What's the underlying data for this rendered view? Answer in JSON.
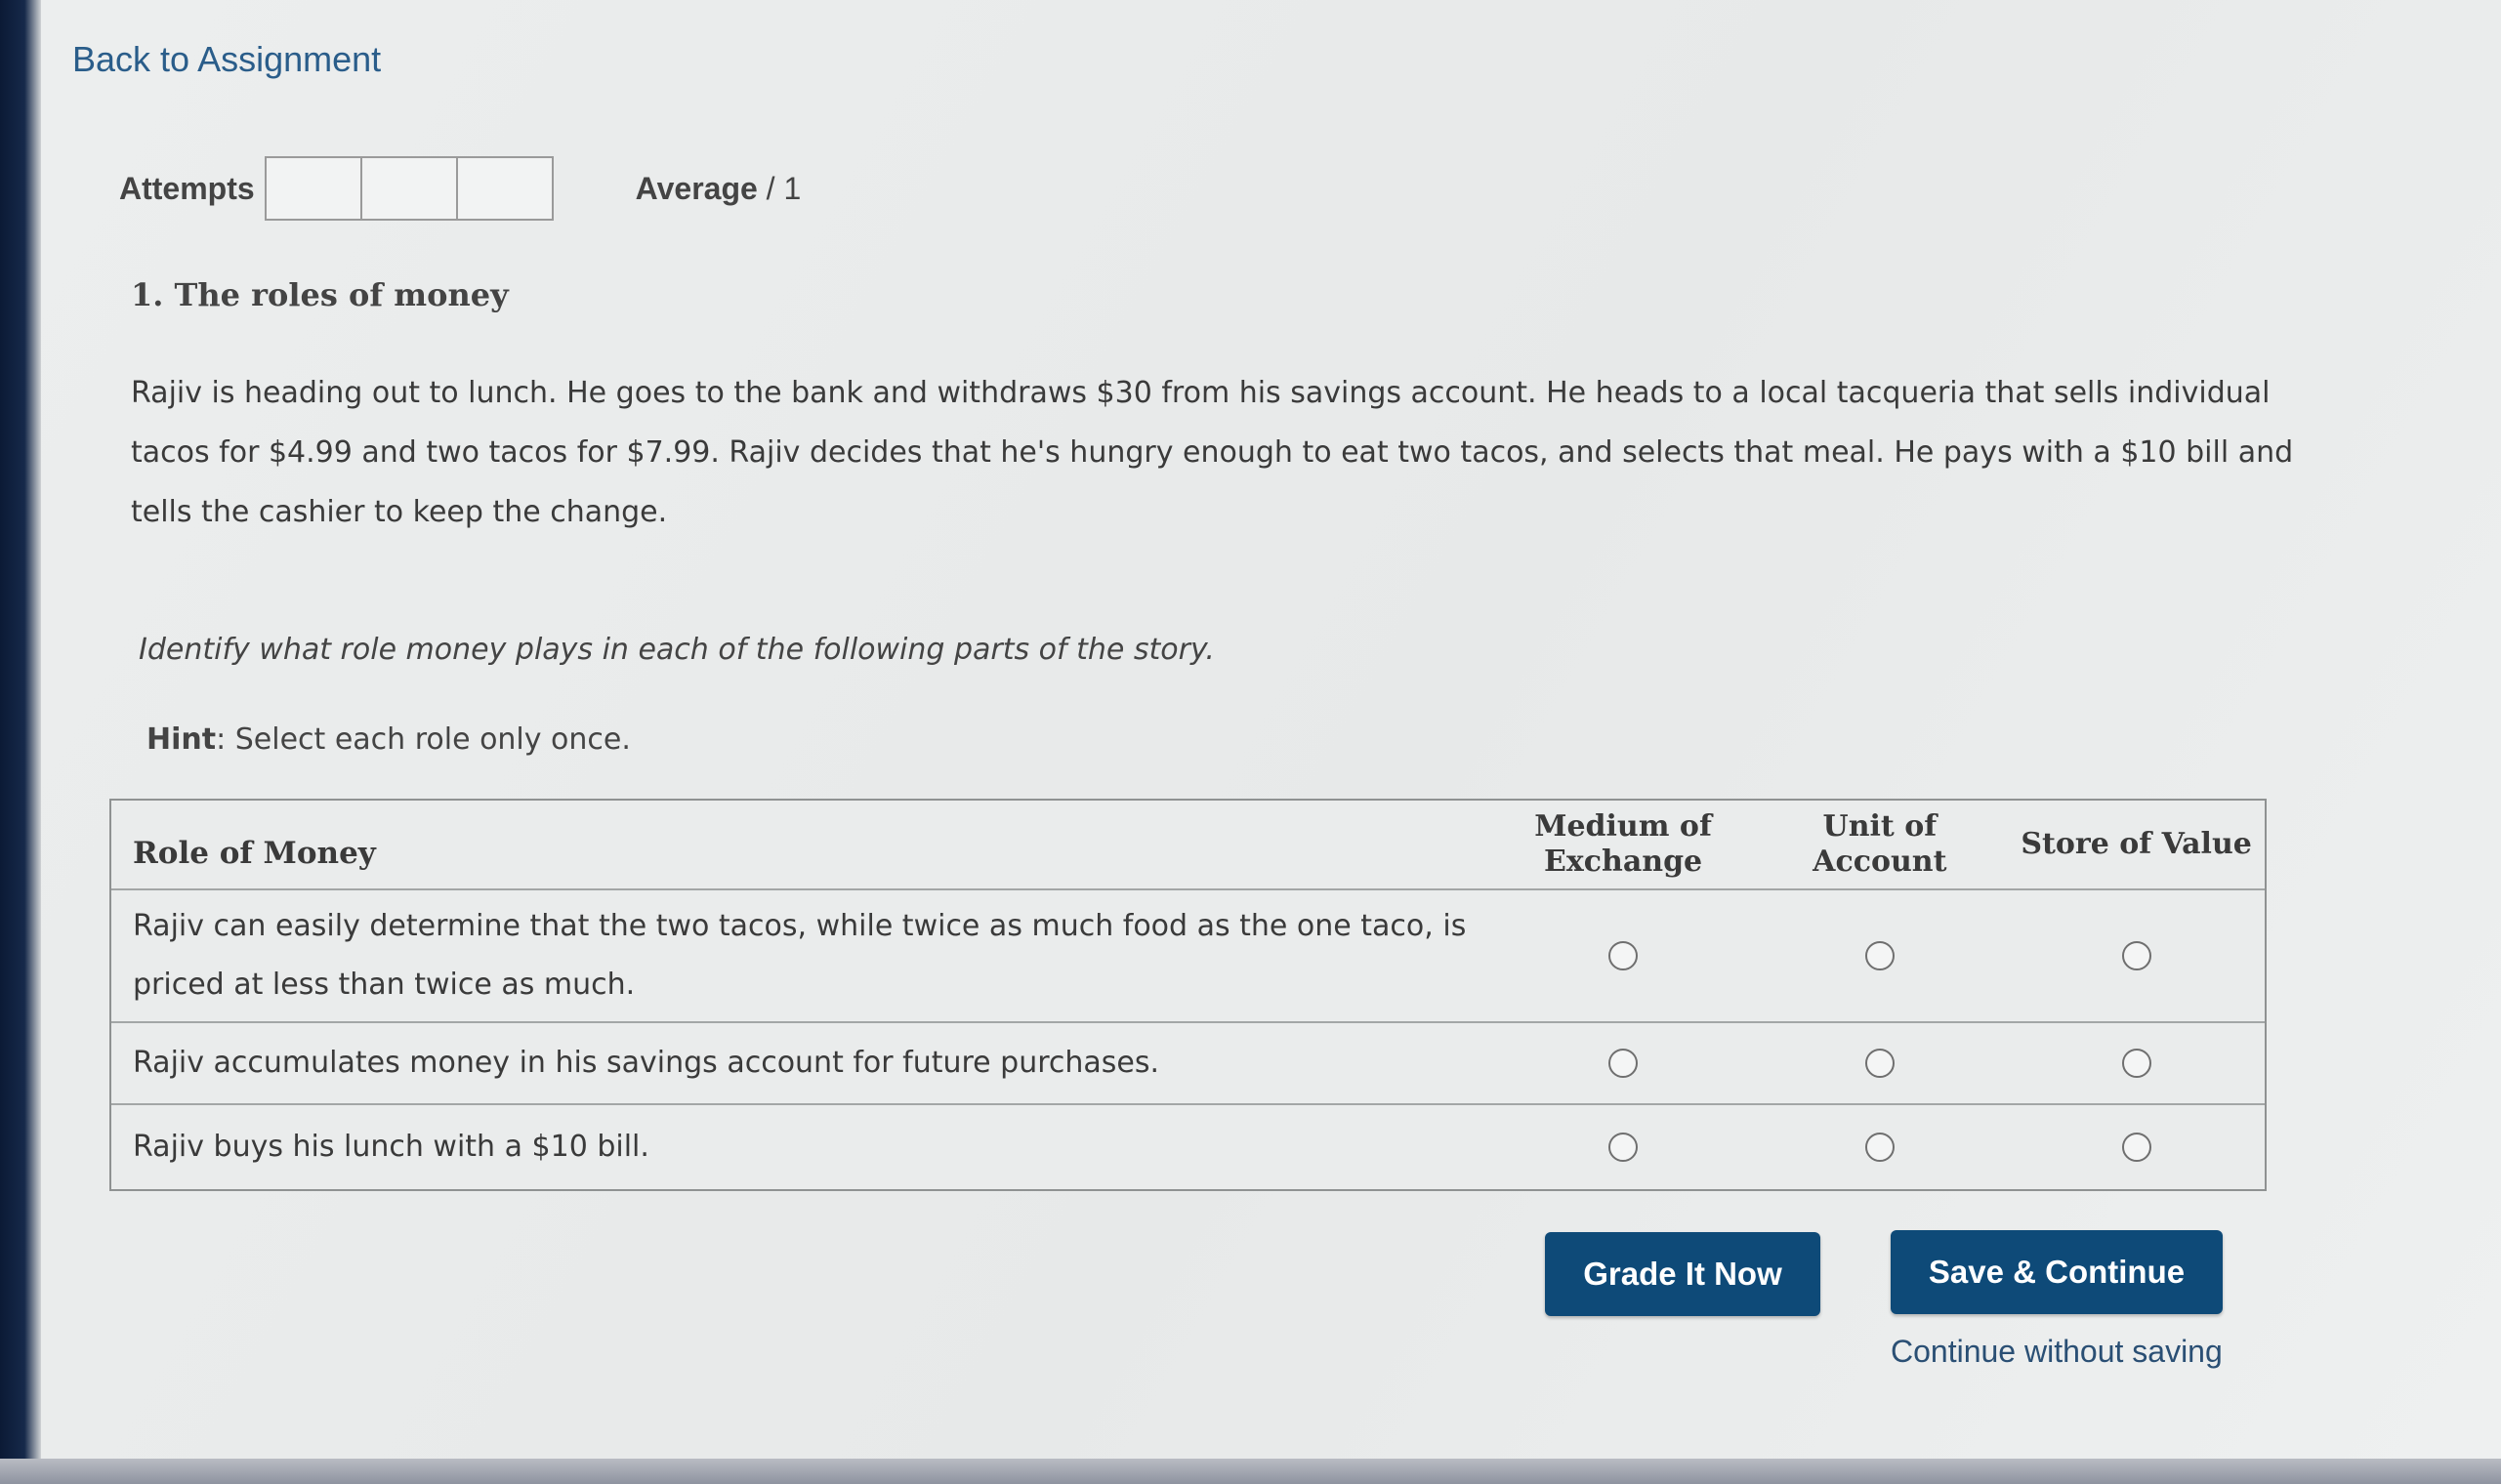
{
  "nav": {
    "back_label": "Back to Assignment"
  },
  "attempts": {
    "label": "Attempts",
    "average_label": "Average",
    "average_value": "/ 1"
  },
  "question": {
    "title": "1. The roles of money",
    "body": "Rajiv is heading out to lunch. He goes to the bank and withdraws $30 from his savings account. He heads to a local tacqueria that sells individual tacos for $4.99 and two tacos for $7.99. Rajiv decides that he's hungry enough to eat two tacos, and selects that meal. He pays with a $10 bill and tells the cashier to keep the change.",
    "instruction": "Identify what role money plays in each of the following parts of the story.",
    "hint_label": "Hint",
    "hint_text": ": Select each role only once."
  },
  "grid": {
    "header": "Role of Money",
    "columns": [
      "Medium of Exchange",
      "Unit of Account",
      "Store of Value"
    ],
    "rows": [
      "Rajiv can easily determine that the two tacos, while twice as much food as the one taco, is priced at less than twice as much.",
      "Rajiv accumulates money in his savings account for future purchases.",
      "Rajiv buys his lunch with a $10 bill."
    ]
  },
  "actions": {
    "grade_label": "Grade It Now",
    "save_label": "Save & Continue",
    "continue_label": "Continue without saving"
  }
}
